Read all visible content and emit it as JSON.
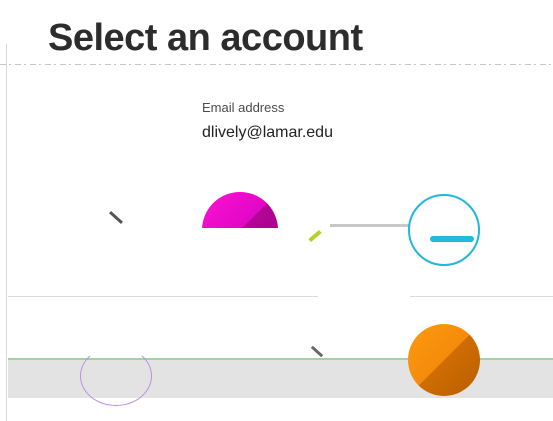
{
  "page": {
    "title": "Select an account"
  },
  "account": {
    "email_label": "Email address",
    "email_value": "dlively@lamar.edu"
  },
  "colors": {
    "personal_avatar": "#e007c6",
    "secondary_ring": "#20b8d8",
    "school_avatar": "#f48b0a"
  },
  "icons": {
    "personal": "person-avatar-icon",
    "school": "school-avatar-icon"
  }
}
